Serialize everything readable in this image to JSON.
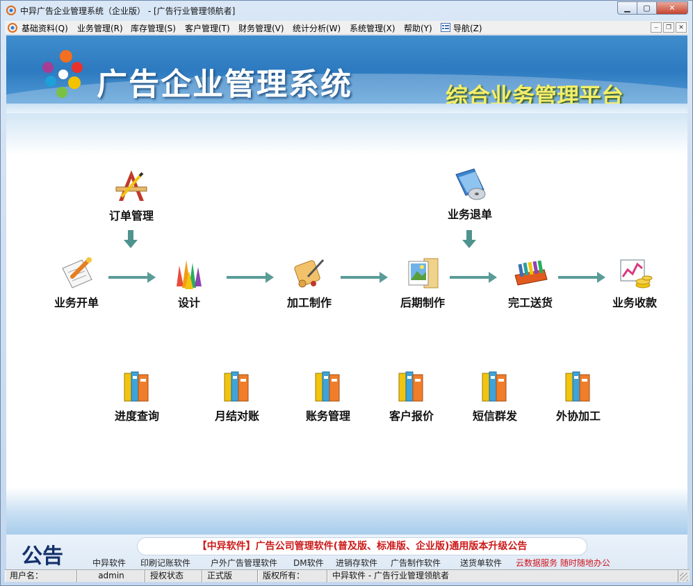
{
  "window": {
    "title": "中异广告企业管理系统（企业版） - [广告行业管理领航者]",
    "controls": {
      "minimize": "▁",
      "maximize": "▢",
      "close": "✕"
    }
  },
  "menu": {
    "items": [
      "基础资料(Q)",
      "业务管理(R)",
      "库存管理(S)",
      "客户管理(T)",
      "财务管理(V)",
      "统计分析(W)",
      "系统管理(X)",
      "帮助(Y)",
      "导航(Z)"
    ],
    "mdi": {
      "minimize": "‒",
      "restore": "❐",
      "close": "✕"
    }
  },
  "banner": {
    "title": "广告企业管理系统",
    "subtitle": "综合业务管理平台"
  },
  "workflow": {
    "order_mgmt": "订单管理",
    "return": "业务退单",
    "open": "业务开单",
    "design": "设计",
    "process": "加工制作",
    "post": "后期制作",
    "deliver": "完工送货",
    "collect": "业务收款"
  },
  "modules": [
    "进度查询",
    "月结对账",
    "账务管理",
    "客户报价",
    "短信群发",
    "外协加工"
  ],
  "notice": {
    "heading": "公告",
    "headline": "【中异软件】广告公司管理软件(普及版、标准版、企业版)通用版本升级公告",
    "links": [
      "中异软件",
      "印刷记账软件",
      "户外广告管理软件",
      "DM软件",
      "进销存软件",
      "广告制作软件",
      "送货单软件"
    ],
    "promo": "云数据服务 随时随地办公"
  },
  "status": {
    "user_label": "用户名：",
    "user": "admin",
    "auth_label": "授权状态",
    "auth": "正式版",
    "copyright_label": "版权所有：",
    "copyright": "中异软件 - 广告行业管理领航者"
  },
  "colors": {
    "arrow": "#5a9c98",
    "notice_red": "#cc1a1a",
    "banner_blue": "#2d7ac0",
    "subtitle_yellow": "#f4ee6a"
  }
}
